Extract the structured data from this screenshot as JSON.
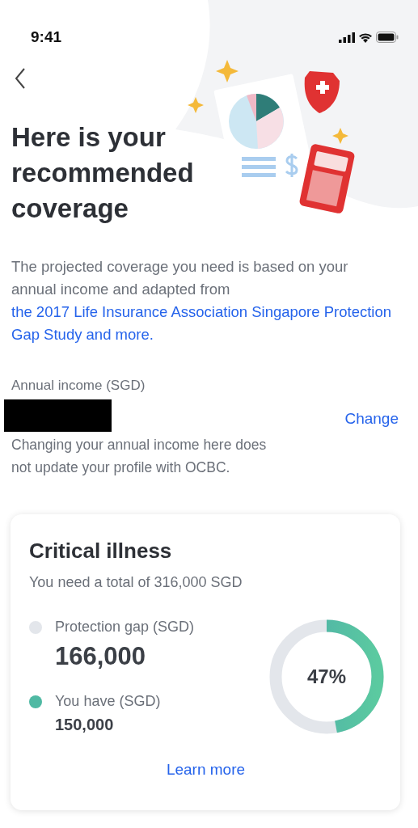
{
  "status_bar": {
    "time": "9:41"
  },
  "title": "Here is your recommended coverage",
  "intro": {
    "text": "The projected coverage you need is based on your annual income and adapted from ",
    "link": "the 2017 Life Insurance Association Singapore Protection Gap Study and more."
  },
  "income": {
    "label": "Annual income (SGD)",
    "redacted": true,
    "action": "Change",
    "note": "Changing your annual income here does not update your profile with OCBC."
  },
  "card": {
    "title": "Critical illness",
    "subtitle": "You need a total of 316,000 SGD",
    "legend": [
      {
        "label": "Protection gap (SGD)",
        "value": "166,000",
        "color": "#e3e6eb",
        "kind": "headline"
      },
      {
        "label": "You have (SGD)",
        "value": "150,000",
        "color": "#4fb9a3",
        "kind": "minor"
      }
    ],
    "ring": {
      "level": 0.47,
      "reading": "47%"
    },
    "link": "Learn more"
  }
}
